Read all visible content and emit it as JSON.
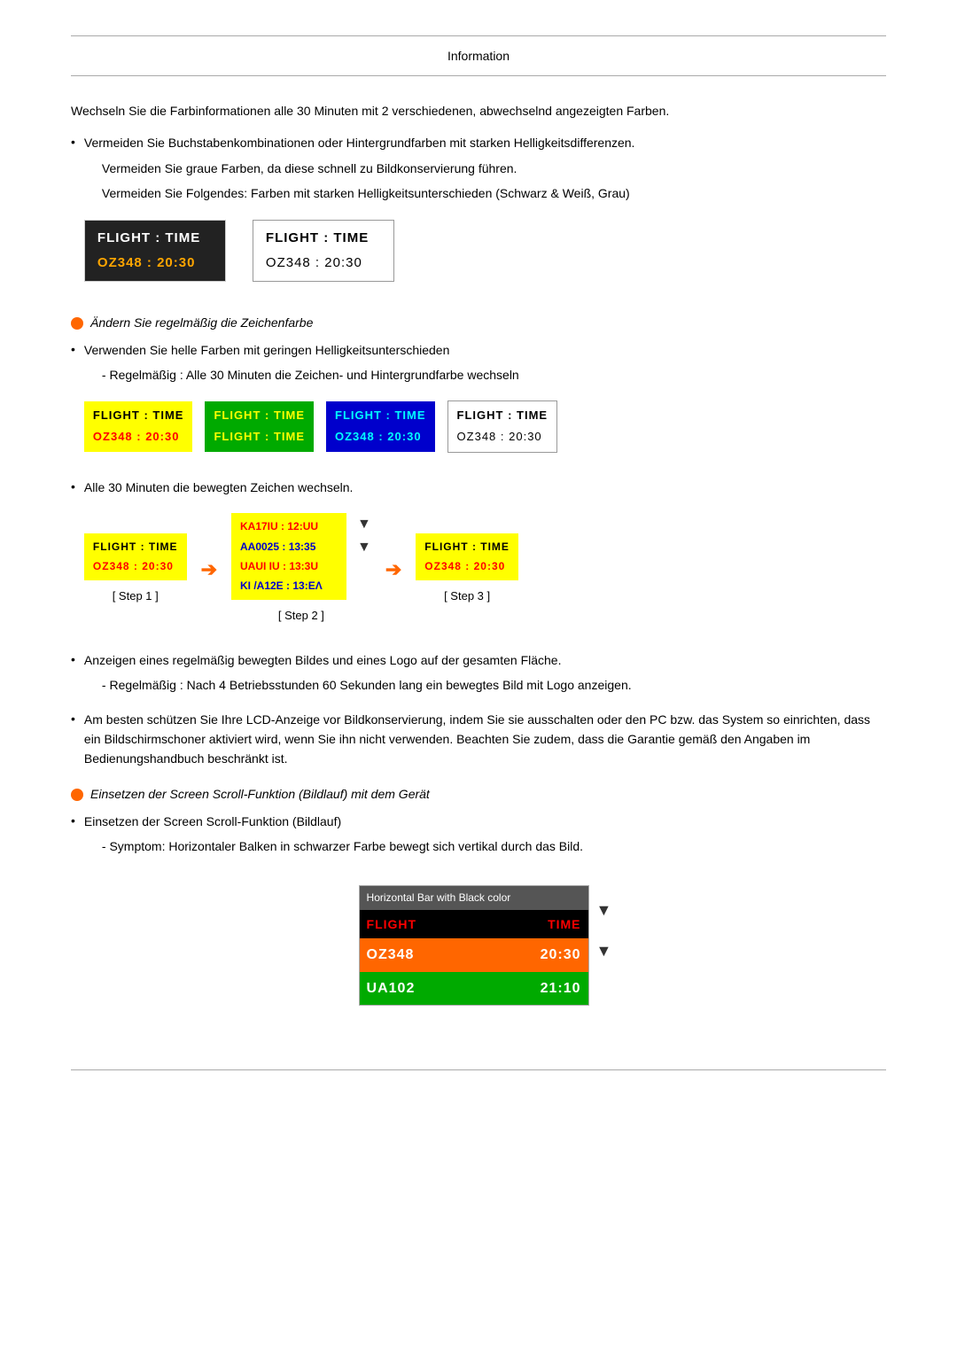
{
  "page": {
    "title": "Information"
  },
  "intro": {
    "para1": "Wechseln Sie die Farbinformationen alle 30 Minuten mit 2 verschiedenen, abwechselnd angezeigten Farben.",
    "bullet1": "Vermeiden Sie Buchstabenkombinationen oder Hintergrundfarben mit starken Helligkeitsdifferenzen.",
    "para2": "Vermeiden Sie graue Farben, da diese schnell zu Bildkonservierung führen.",
    "para3": "Vermeiden Sie Folgendes: Farben mit starken Helligkeitsunterschieden (Schwarz & Weiß, Grau)"
  },
  "demo1": {
    "box1_header": "FLIGHT  :  TIME",
    "box1_data": "OZ348   :  20:30",
    "box2_header": "FLIGHT  :  TIME",
    "box2_data": "OZ348   :  20:30"
  },
  "section2": {
    "heading": "Ändern Sie regelmäßig die Zeichenfarbe",
    "bullet1": "Verwenden Sie helle Farben mit geringen Helligkeitsunterschieden",
    "sub1": "- Regelmäßig : Alle 30 Minuten die Zeichen- und Hintergrundfarbe wechseln"
  },
  "colorBoxes": {
    "yellow": {
      "header": "FLIGHT  :  TIME",
      "data": "OZ348   :  20:30"
    },
    "green": {
      "header": "FLIGHT  :  TIME",
      "data": "FLIGHT  :  TIME"
    },
    "blue": {
      "header": "FLIGHT  :  TIME",
      "data": "OZ348   :  20:30"
    },
    "white": {
      "header": "FLIGHT  :  TIME",
      "data": "OZ348   :  20:30"
    }
  },
  "section3": {
    "bullet1": "Alle 30 Minuten die bewegten Zeichen wechseln.",
    "step1_header": "FLIGHT  :  TIME",
    "step1_data": "OZ348   :  20:30",
    "step1_label": "[ Step 1 ]",
    "step2_line1": "KA17IU  :  12:UU",
    "step2_line2": "AA0025  :  13:35",
    "step2_line3": "UAUI IU  :  13:3U",
    "step2_line4": "KI /A12E  :  13:ΕΛ",
    "step2_label": "[ Step 2 ]",
    "step3_header": "FLIGHT  :  TIME",
    "step3_data": "OZ348   :  20:30",
    "step3_label": "[ Step 3 ]"
  },
  "section4": {
    "bullet1": "Anzeigen eines regelmäßig bewegten Bildes und eines Logo auf der gesamten Fläche.",
    "sub1": "- Regelmäßig : Nach 4 Betriebsstunden 60 Sekunden lang ein bewegtes Bild mit Logo anzeigen."
  },
  "section5": {
    "bullet1": "Am besten schützen Sie Ihre LCD-Anzeige vor Bildkonservierung, indem Sie sie ausschalten oder den PC bzw. das System so einrichten, dass ein Bildschirmschoner aktiviert wird, wenn Sie ihn nicht verwenden. Beachten Sie zudem, dass die Garantie gemäß den Angaben im Bedienungshandbuch beschränkt ist."
  },
  "section6": {
    "heading": "Einsetzen der Screen Scroll-Funktion (Bildlauf) mit dem Gerät",
    "bullet1": "Einsetzen der Screen Scroll-Funktion (Bildlauf)",
    "sub1": "- Symptom: Horizontaler Balken in schwarzer Farbe bewegt sich vertikal durch das Bild."
  },
  "hbar": {
    "title": "Horizontal Bar with Black color",
    "header_flight": "FLIGHT",
    "header_time": "TIME",
    "row1_flight": "OZ348",
    "row1_time": "20:30",
    "row2_flight": "UA102",
    "row2_time": "21:10"
  }
}
